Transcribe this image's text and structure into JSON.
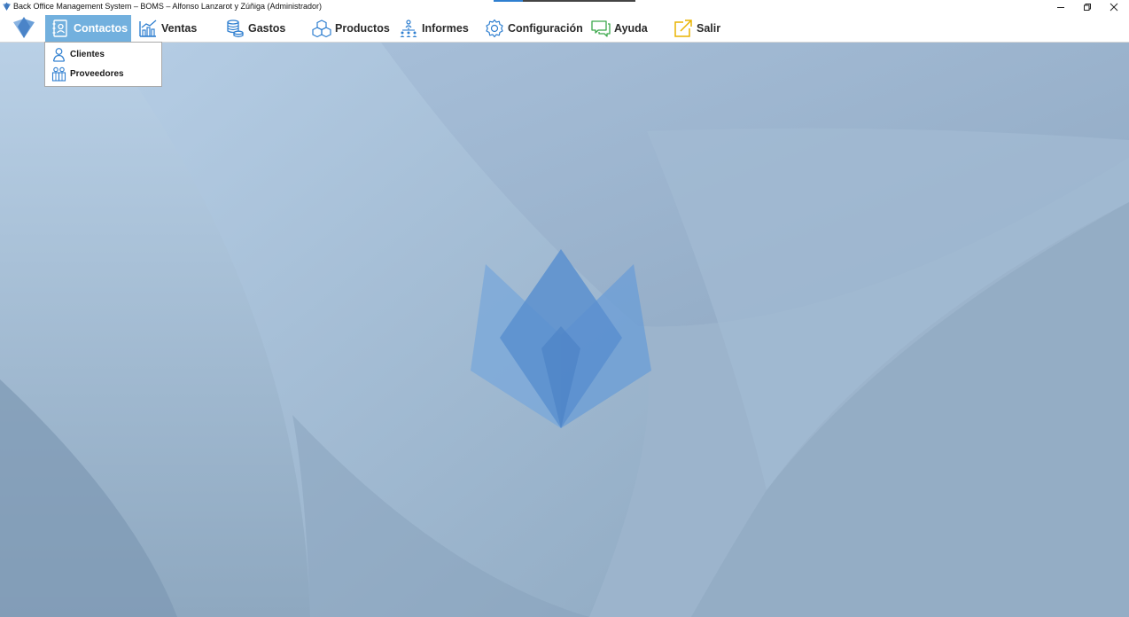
{
  "window": {
    "title": "Back Office Management System – BOMS – Alfonso Lanzarot y Zúñiga (Administrador)",
    "minimize_icon": "minimize-icon",
    "restore_icon": "restore-icon",
    "close_icon": "close-icon"
  },
  "menu": {
    "items": [
      {
        "label": "Contactos",
        "icon": "contacts-icon",
        "active": true
      },
      {
        "label": "Ventas",
        "icon": "sales-chart-icon"
      },
      {
        "label": "Gastos",
        "icon": "coins-stack-icon"
      },
      {
        "label": "Productos",
        "icon": "boxes-icon"
      },
      {
        "label": "Informes",
        "icon": "reports-people-icon"
      },
      {
        "label": "Configuración",
        "icon": "gear-icon"
      },
      {
        "label": "Ayuda",
        "icon": "chat-bubble-icon"
      },
      {
        "label": "Salir",
        "icon": "exit-icon"
      }
    ]
  },
  "submenu": {
    "items": [
      {
        "label": "Clientes",
        "icon": "client-icon"
      },
      {
        "label": "Proveedores",
        "icon": "suppliers-icon"
      }
    ]
  },
  "colors": {
    "active_menu": "#72b0de",
    "icon_blue": "#2f7fd0",
    "icon_green": "#3aa84a",
    "icon_yellow": "#e8b400",
    "background": "#a8c0d8"
  }
}
